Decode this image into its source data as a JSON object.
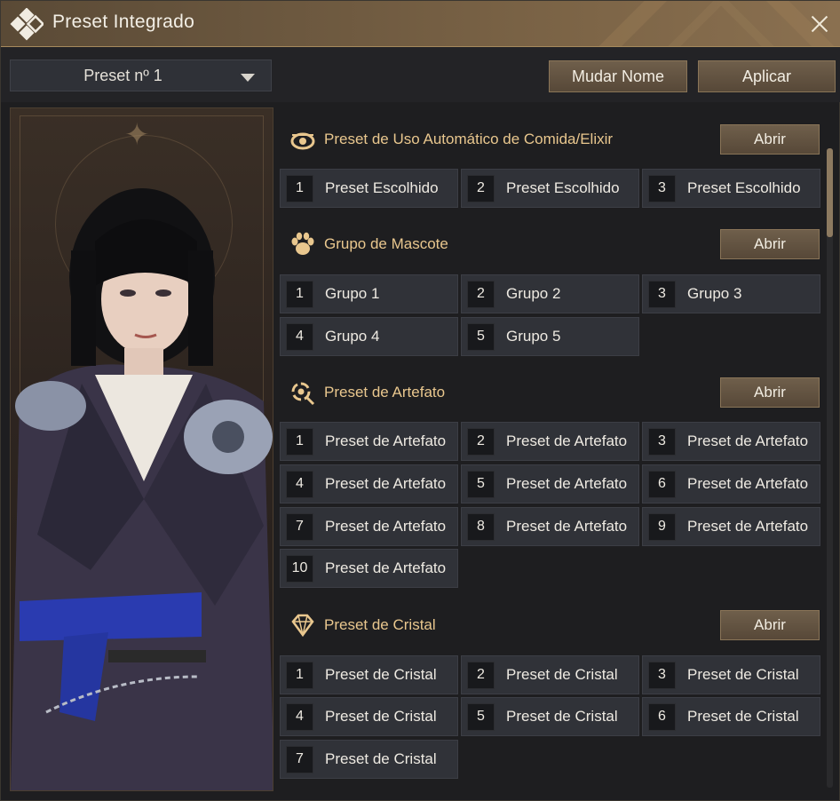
{
  "window": {
    "title": "Preset Integrado"
  },
  "toolbar": {
    "preset_selected": "Preset nº 1",
    "rename_label": "Mudar Nome",
    "apply_label": "Aplicar"
  },
  "sections": {
    "food": {
      "title": "Preset de Uso Automático de Comida/Elixir",
      "open_label": "Abrir",
      "slots": [
        {
          "num": "1",
          "name": "Preset Escolhido"
        },
        {
          "num": "2",
          "name": "Preset Escolhido"
        },
        {
          "num": "3",
          "name": "Preset Escolhido"
        }
      ]
    },
    "pet": {
      "title": "Grupo de Mascote",
      "open_label": "Abrir",
      "slots": [
        {
          "num": "1",
          "name": "Grupo 1"
        },
        {
          "num": "2",
          "name": "Grupo 2"
        },
        {
          "num": "3",
          "name": "Grupo 3"
        },
        {
          "num": "4",
          "name": "Grupo 4"
        },
        {
          "num": "5",
          "name": "Grupo 5"
        }
      ]
    },
    "artifact": {
      "title": "Preset de Artefato",
      "open_label": "Abrir",
      "slots": [
        {
          "num": "1",
          "name": "Preset de Artefato"
        },
        {
          "num": "2",
          "name": "Preset de Artefato"
        },
        {
          "num": "3",
          "name": "Preset de Artefato"
        },
        {
          "num": "4",
          "name": "Preset de Artefato"
        },
        {
          "num": "5",
          "name": "Preset de Artefato"
        },
        {
          "num": "6",
          "name": "Preset de Artefato"
        },
        {
          "num": "7",
          "name": "Preset de Artefato"
        },
        {
          "num": "8",
          "name": "Preset de Artefato"
        },
        {
          "num": "9",
          "name": "Preset de Artefato"
        },
        {
          "num": "10",
          "name": "Preset de Artefato"
        }
      ]
    },
    "crystal": {
      "title": "Preset de Cristal",
      "open_label": "Abrir",
      "slots": [
        {
          "num": "1",
          "name": "Preset de Cristal"
        },
        {
          "num": "2",
          "name": "Preset de Cristal"
        },
        {
          "num": "3",
          "name": "Preset de Cristal"
        },
        {
          "num": "4",
          "name": "Preset de Cristal"
        },
        {
          "num": "5",
          "name": "Preset de Cristal"
        },
        {
          "num": "6",
          "name": "Preset de Cristal"
        },
        {
          "num": "7",
          "name": "Preset de Cristal"
        }
      ]
    }
  },
  "icons": {
    "title_logo": "diamond-logo-icon",
    "close": "close-icon",
    "dropdown": "chevron-down-icon",
    "food": "food-icon",
    "pet": "paw-icon",
    "artifact": "artifact-icon",
    "crystal": "crystal-icon"
  },
  "colors": {
    "accent_title": "#e9c78e",
    "button_bg": "#6f5f4b",
    "slot_bg": "#303238"
  }
}
